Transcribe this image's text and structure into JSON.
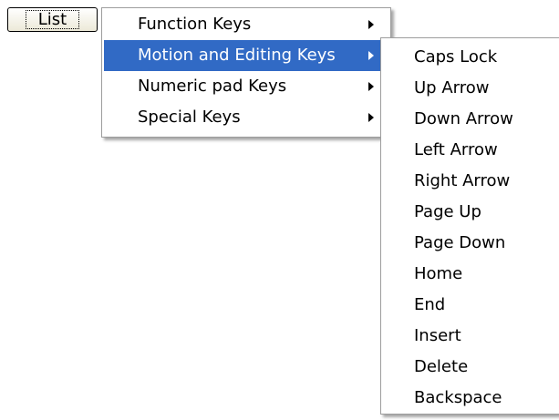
{
  "button": {
    "label": "List"
  },
  "main_menu": {
    "items": [
      {
        "label": "Function Keys",
        "has_submenu": true,
        "selected": false
      },
      {
        "label": "Motion and Editing Keys",
        "has_submenu": true,
        "selected": true
      },
      {
        "label": "Numeric pad Keys",
        "has_submenu": true,
        "selected": false
      },
      {
        "label": "Special Keys",
        "has_submenu": true,
        "selected": false
      }
    ]
  },
  "sub_menu": {
    "items": [
      {
        "label": "Caps Lock"
      },
      {
        "label": "Up Arrow"
      },
      {
        "label": "Down Arrow"
      },
      {
        "label": "Left Arrow"
      },
      {
        "label": "Right Arrow"
      },
      {
        "label": "Page Up"
      },
      {
        "label": "Page Down"
      },
      {
        "label": "Home"
      },
      {
        "label": "End"
      },
      {
        "label": "Insert"
      },
      {
        "label": "Delete"
      },
      {
        "label": "Backspace"
      }
    ]
  },
  "colors": {
    "highlight": "#316ac5",
    "menu_border": "#9d9d9d",
    "background": "#ffffff"
  }
}
